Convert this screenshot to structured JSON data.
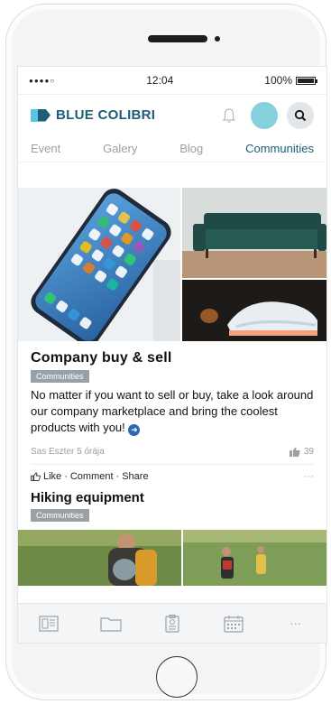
{
  "status_bar": {
    "signal": "●●●●○",
    "time": "12:04",
    "battery": "100%"
  },
  "header": {
    "brand": "BLUE COLIBRI"
  },
  "tabs": [
    {
      "label": "Event",
      "active": false
    },
    {
      "label": "Galery",
      "active": false
    },
    {
      "label": "Blog",
      "active": false
    },
    {
      "label": "Communities",
      "active": true
    }
  ],
  "post1": {
    "title": "Company buy & sell",
    "tag": "Communities",
    "text": "No matter if you want to sell or buy, take a look around our company marketplace and bring the coolest products with you!",
    "author": "Sas Eszter",
    "time": "5 órája",
    "likes": "39",
    "like_label": "Like",
    "comment_label": "Comment",
    "share_label": "Share",
    "more": "···"
  },
  "post2": {
    "title": "Hiking equipment",
    "tag": "Communities"
  },
  "colors": {
    "brand": "#1c5d78",
    "accent": "#5ac3de",
    "avatar": "#86cfdd",
    "link_arrow": "#2e66b8"
  },
  "bottom_nav": [
    {
      "icon": "news-icon"
    },
    {
      "icon": "folder-icon"
    },
    {
      "icon": "badge-icon"
    },
    {
      "icon": "calendar-icon"
    },
    {
      "icon": "more-dots-icon",
      "label": "···"
    }
  ]
}
